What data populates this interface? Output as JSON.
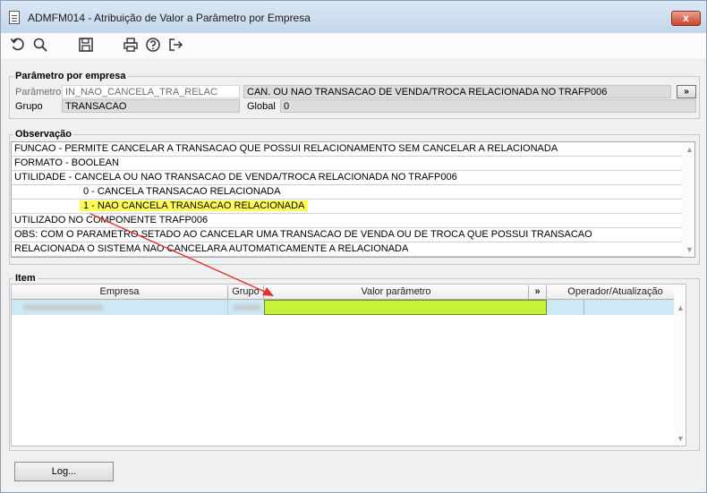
{
  "window": {
    "title": "ADMFM014 - Atribuição de Valor a Parâmetro por Empresa",
    "close_label": "x"
  },
  "toolbar": {
    "icons": [
      "undo-icon",
      "search-icon",
      "save-icon",
      "print-icon",
      "help-icon",
      "exit-icon"
    ]
  },
  "parametro": {
    "legend": "Parâmetro por empresa",
    "parametro_label": "Parâmetro",
    "parametro_value": "IN_NAO_CANCELA_TRA_RELAC",
    "descricao_value": "CAN. OU NAO TRANSACAO DE VENDA/TROCA RELACIONADA NO TRAFP006",
    "more_label": "»",
    "grupo_label": "Grupo",
    "grupo_value": "TRANSACAO",
    "global_label": "Global",
    "global_value": "0"
  },
  "observacao": {
    "legend": "Observação",
    "lines": [
      "FUNCAO - PERMITE CANCELAR A TRANSACAO QUE POSSUI RELACIONAMENTO SEM CANCELAR A RELACIONADA",
      "FORMATO - BOOLEAN",
      "UTILIDADE - CANCELA OU NAO TRANSACAO DE VENDA/TROCA RELACIONADA NO TRAFP006",
      "0 - CANCELA TRANSACAO RELACIONADA",
      "1 - NAO CANCELA TRANSACAO RELACIONADA",
      "UTILIZADO NO COMPONENTE TRAFP006",
      "OBS: COM O PARAMETRO SETADO AO CANCELAR UMA TRANSACAO DE VENDA OU DE TROCA QUE POSSUI TRANSACAO",
      "RELACIONADA O SISTEMA NAO CANCELARA AUTOMATICAMENTE A RELACIONADA"
    ]
  },
  "item": {
    "legend": "Item",
    "columns": {
      "empresa": "Empresa",
      "grupo": "Grupo",
      "valor": "Valor parâmetro",
      "more": "»",
      "operador": "Operador/Atualização"
    }
  },
  "footer": {
    "log_label": "Log..."
  },
  "colors": {
    "highlight": "#ffff55",
    "valor_cell": "#c6f23a",
    "row_selected": "#cce9f5",
    "annotation_arrow": "#e53030"
  }
}
